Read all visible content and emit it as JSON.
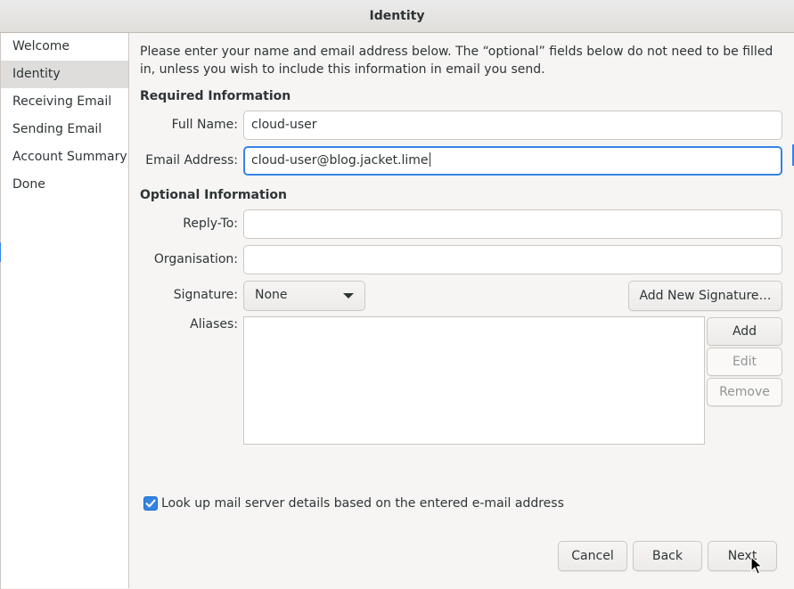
{
  "window": {
    "title": "Identity"
  },
  "sidebar": {
    "items": [
      {
        "label": "Welcome"
      },
      {
        "label": "Identity"
      },
      {
        "label": "Receiving Email"
      },
      {
        "label": "Sending Email"
      },
      {
        "label": "Account Summary"
      },
      {
        "label": "Done"
      }
    ],
    "selected": "Identity"
  },
  "main": {
    "intro": "Please enter your name and email address below. The “optional” fields below do not need to be filled in, unless you wish to include this information in email you send.",
    "required": {
      "heading": "Required Information",
      "full_name_label": "Full Name:",
      "full_name_value": "cloud-user",
      "email_label": "Email Address:",
      "email_value": "cloud-user@blog.jacket.lime"
    },
    "optional": {
      "heading": "Optional Information",
      "reply_to_label": "Reply-To:",
      "reply_to_value": "",
      "organisation_label": "Organisation:",
      "organisation_value": "",
      "signature_label": "Signature:",
      "signature_value": "None",
      "add_signature_label": "Add New Signature…",
      "aliases_label": "Aliases:",
      "add_label": "Add",
      "edit_label": "Edit",
      "remove_label": "Remove"
    },
    "lookup_checkbox": {
      "label": "Look up mail server details based on the entered e-mail address",
      "checked": true
    }
  },
  "footer": {
    "cancel_label": "Cancel",
    "back_label": "Back",
    "next_label": "Next"
  },
  "colors": {
    "accent": "#3584e4",
    "selection": "#dedddc",
    "text": "#2e3436",
    "disabled_text": "#929595"
  }
}
